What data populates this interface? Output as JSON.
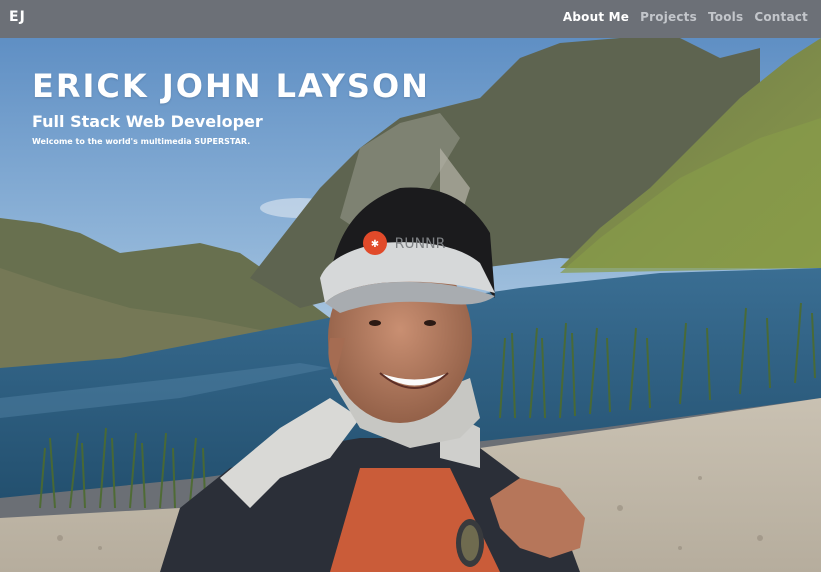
{
  "navbar": {
    "brand": "EJ",
    "links": [
      {
        "label": "About Me",
        "active": true
      },
      {
        "label": "Projects",
        "active": false
      },
      {
        "label": "Tools",
        "active": false
      },
      {
        "label": "Contact",
        "active": false
      }
    ]
  },
  "hero": {
    "title": "ERICK JOHN LAYSON",
    "subtitle": "Full Stack Web Developer",
    "tagline": "Welcome to the world's multimedia SUPERSTAR.",
    "cap_text": "RUNNR"
  },
  "colors": {
    "navbar_bg": "#6c7077",
    "nav_active": "#ffffff",
    "nav_inactive": "#c3c6cb",
    "sky": "#6f9ccb",
    "lake": "#2f5f86",
    "mountain": "#5e6a4a",
    "sand": "#cbc3b6"
  }
}
